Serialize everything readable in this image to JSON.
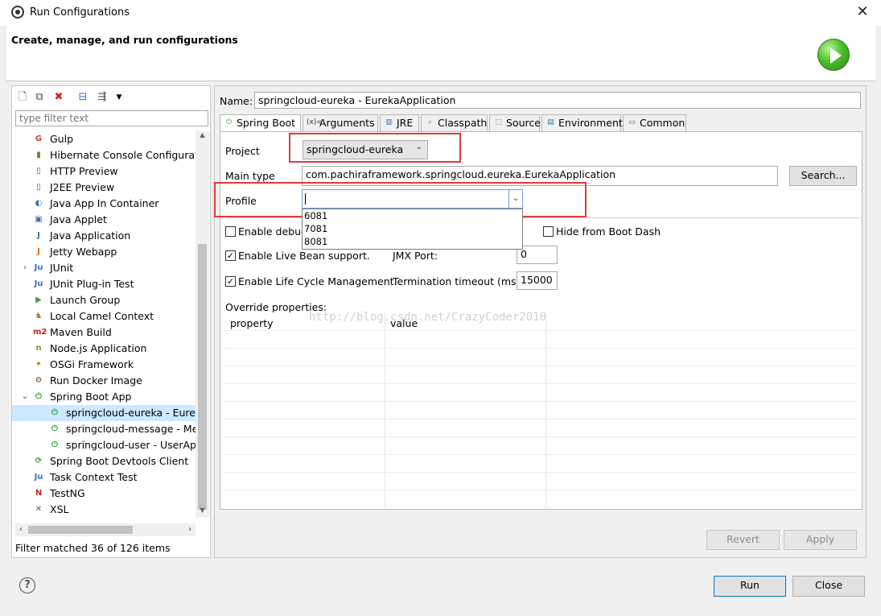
{
  "window": {
    "title": "Run Configurations",
    "close_label": "✕"
  },
  "banner": {
    "heading": "Create, manage, and run configurations"
  },
  "left": {
    "filter_placeholder": "type filter text",
    "tree": [
      {
        "label": "Gulp",
        "icon": "G",
        "color": "#cf3b3b",
        "indent": 0
      },
      {
        "label": "Hibernate Console Configuration",
        "icon": "▮",
        "color": "#8a6d3b",
        "indent": 0
      },
      {
        "label": "HTTP Preview",
        "icon": "▯",
        "color": "#555",
        "indent": 0
      },
      {
        "label": "J2EE Preview",
        "icon": "▯",
        "color": "#555",
        "indent": 0
      },
      {
        "label": "Java App In Container",
        "icon": "◐",
        "color": "#3b6fb6",
        "indent": 0
      },
      {
        "label": "Java Applet",
        "icon": "▣",
        "color": "#3b6fb6",
        "indent": 0
      },
      {
        "label": "Java Application",
        "icon": "J",
        "color": "#3b6fb6",
        "indent": 0
      },
      {
        "label": "Jetty Webapp",
        "icon": "J",
        "color": "#e06b1f",
        "indent": 0
      },
      {
        "label": "JUnit",
        "icon": "Ju",
        "color": "#3b6fb6",
        "indent": 0,
        "expander": "›"
      },
      {
        "label": "JUnit Plug-in Test",
        "icon": "Ju",
        "color": "#3b6fb6",
        "indent": 0
      },
      {
        "label": "Launch Group",
        "icon": "▶",
        "color": "#3a9a3a",
        "indent": 0
      },
      {
        "label": "Local Camel Context",
        "icon": "♞",
        "color": "#b0782a",
        "indent": 0
      },
      {
        "label": "Maven Build",
        "icon": "m2",
        "color": "#c22",
        "indent": 0
      },
      {
        "label": "Node.js Application",
        "icon": "n",
        "color": "#6a9f2a",
        "indent": 0
      },
      {
        "label": "OSGi Framework",
        "icon": "✦",
        "color": "#b57a2a",
        "indent": 0
      },
      {
        "label": "Run Docker Image",
        "icon": "⚙",
        "color": "#6b4a2a",
        "indent": 0
      },
      {
        "label": "Spring Boot App",
        "icon": "⏻",
        "color": "#2ea02e",
        "indent": 0,
        "expander": "⌄"
      },
      {
        "label": "springcloud-eureka - EurekaApplication",
        "icon": "⏻",
        "color": "#2ea02e",
        "indent": 1,
        "selected": true
      },
      {
        "label": "springcloud-message - MessageApplication",
        "icon": "⏻",
        "color": "#2ea02e",
        "indent": 1
      },
      {
        "label": "springcloud-user - UserApplication",
        "icon": "⏻",
        "color": "#2ea02e",
        "indent": 1
      },
      {
        "label": "Spring Boot Devtools Client",
        "icon": "⟳",
        "color": "#2ea02e",
        "indent": 0
      },
      {
        "label": "Task Context Test",
        "icon": "Ju",
        "color": "#3b6fb6",
        "indent": 0
      },
      {
        "label": "TestNG",
        "icon": "N",
        "color": "#b22",
        "indent": 0
      },
      {
        "label": "XSL",
        "icon": "✕",
        "color": "#555",
        "indent": 0
      }
    ],
    "filter_status": "Filter matched 36 of 126 items"
  },
  "right": {
    "name_label": "Name:",
    "name_value": "springcloud-eureka - EurekaApplication",
    "tabs": [
      {
        "label": "Spring Boot",
        "icon": "⏻",
        "color": "#2ea02e",
        "active": true
      },
      {
        "label": "Arguments",
        "icon": "(x)=",
        "color": "#333"
      },
      {
        "label": "JRE",
        "icon": "▥",
        "color": "#3b6fb6"
      },
      {
        "label": "Classpath",
        "icon": "⌕",
        "color": "#b0782a"
      },
      {
        "label": "Source",
        "icon": "⬚",
        "color": "#555"
      },
      {
        "label": "Environment",
        "icon": "▤",
        "color": "#3b6fb6"
      },
      {
        "label": "Common",
        "icon": "▭",
        "color": "#555"
      }
    ],
    "project_label": "Project",
    "project_value": "springcloud-eureka",
    "main_type_label": "Main type",
    "main_type_value": "com.pachiraframework.springcloud.eureka.EurekaApplication",
    "search_button": "Search...",
    "profile_label": "Profile",
    "profile_options": [
      "6081",
      "7081",
      "8081"
    ],
    "enable_debug_label": "Enable debug",
    "hide_boot_dash_label": "Hide from Boot Dash",
    "enable_live_bean_label": "Enable Live Bean support.",
    "jmx_port_label": "JMX Port:",
    "jmx_port_value": "0",
    "enable_lifecycle_label": "Enable Life Cycle Management.",
    "termination_timeout_label": "Termination timeout (ms):",
    "termination_timeout_value": "15000",
    "override_label": "Override properties:",
    "col_property": "property",
    "col_value": "value",
    "watermark": "http://blog.csdn.net/CrazyCoder2010",
    "revert_button": "Revert",
    "apply_button": "Apply"
  },
  "footer": {
    "help_icon": "?",
    "run_button": "Run",
    "close_button": "Close"
  }
}
